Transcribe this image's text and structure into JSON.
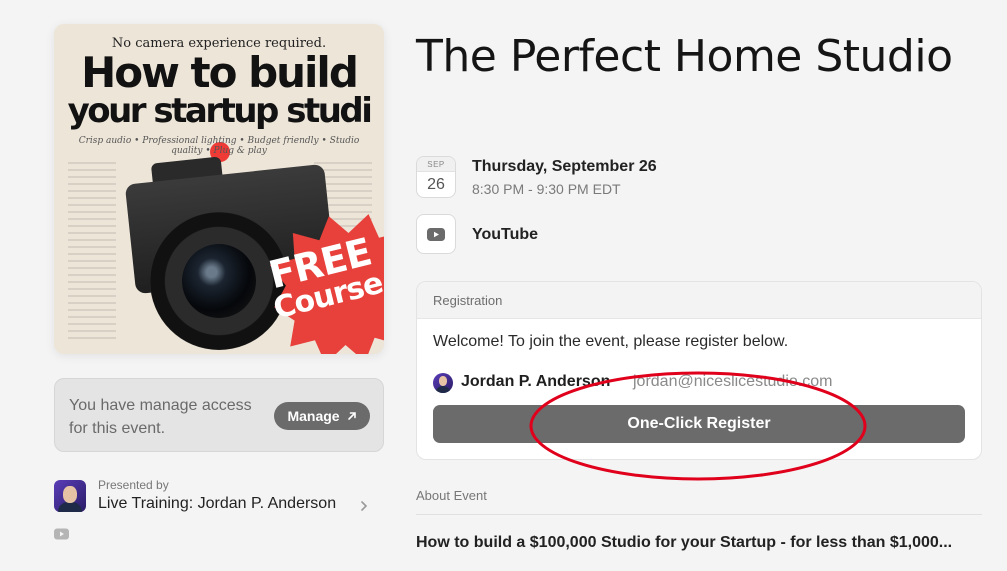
{
  "cover": {
    "top_line": "No camera experience required.",
    "headline_line1": "How to build",
    "headline_line2": "your startup studi",
    "subline": "Crisp audio • Professional lighting • Budget friendly • Studio quality • Plug & play",
    "badge_line1": "FREE",
    "badge_line2": "Course",
    "accent_color": "#e8403a"
  },
  "manage": {
    "text": "You have manage access for this event.",
    "button_label": "Manage",
    "button_icon": "arrow-up-right-icon"
  },
  "presenter": {
    "caption": "Presented by",
    "name": "Live Training: Jordan P. Anderson",
    "chevron_icon": "chevron-right-icon"
  },
  "event": {
    "title": "The Perfect Home Studio",
    "date_month": "SEP",
    "date_day": "26",
    "date_full": "Thursday, September 26",
    "time_range": "8:30 PM - 9:30 PM EDT",
    "location": "YouTube",
    "location_icon": "youtube-icon"
  },
  "registration": {
    "header": "Registration",
    "welcome": "Welcome! To join the event, please register below.",
    "user_name": "Jordan P. Anderson",
    "user_email": "jordan@niceslicestudio.com",
    "button_label": "One-Click Register",
    "annotation_color": "#e0001b"
  },
  "about": {
    "label": "About Event",
    "text": "How to build a $100,000 Studio for your Startup - for less than $1,000..."
  }
}
